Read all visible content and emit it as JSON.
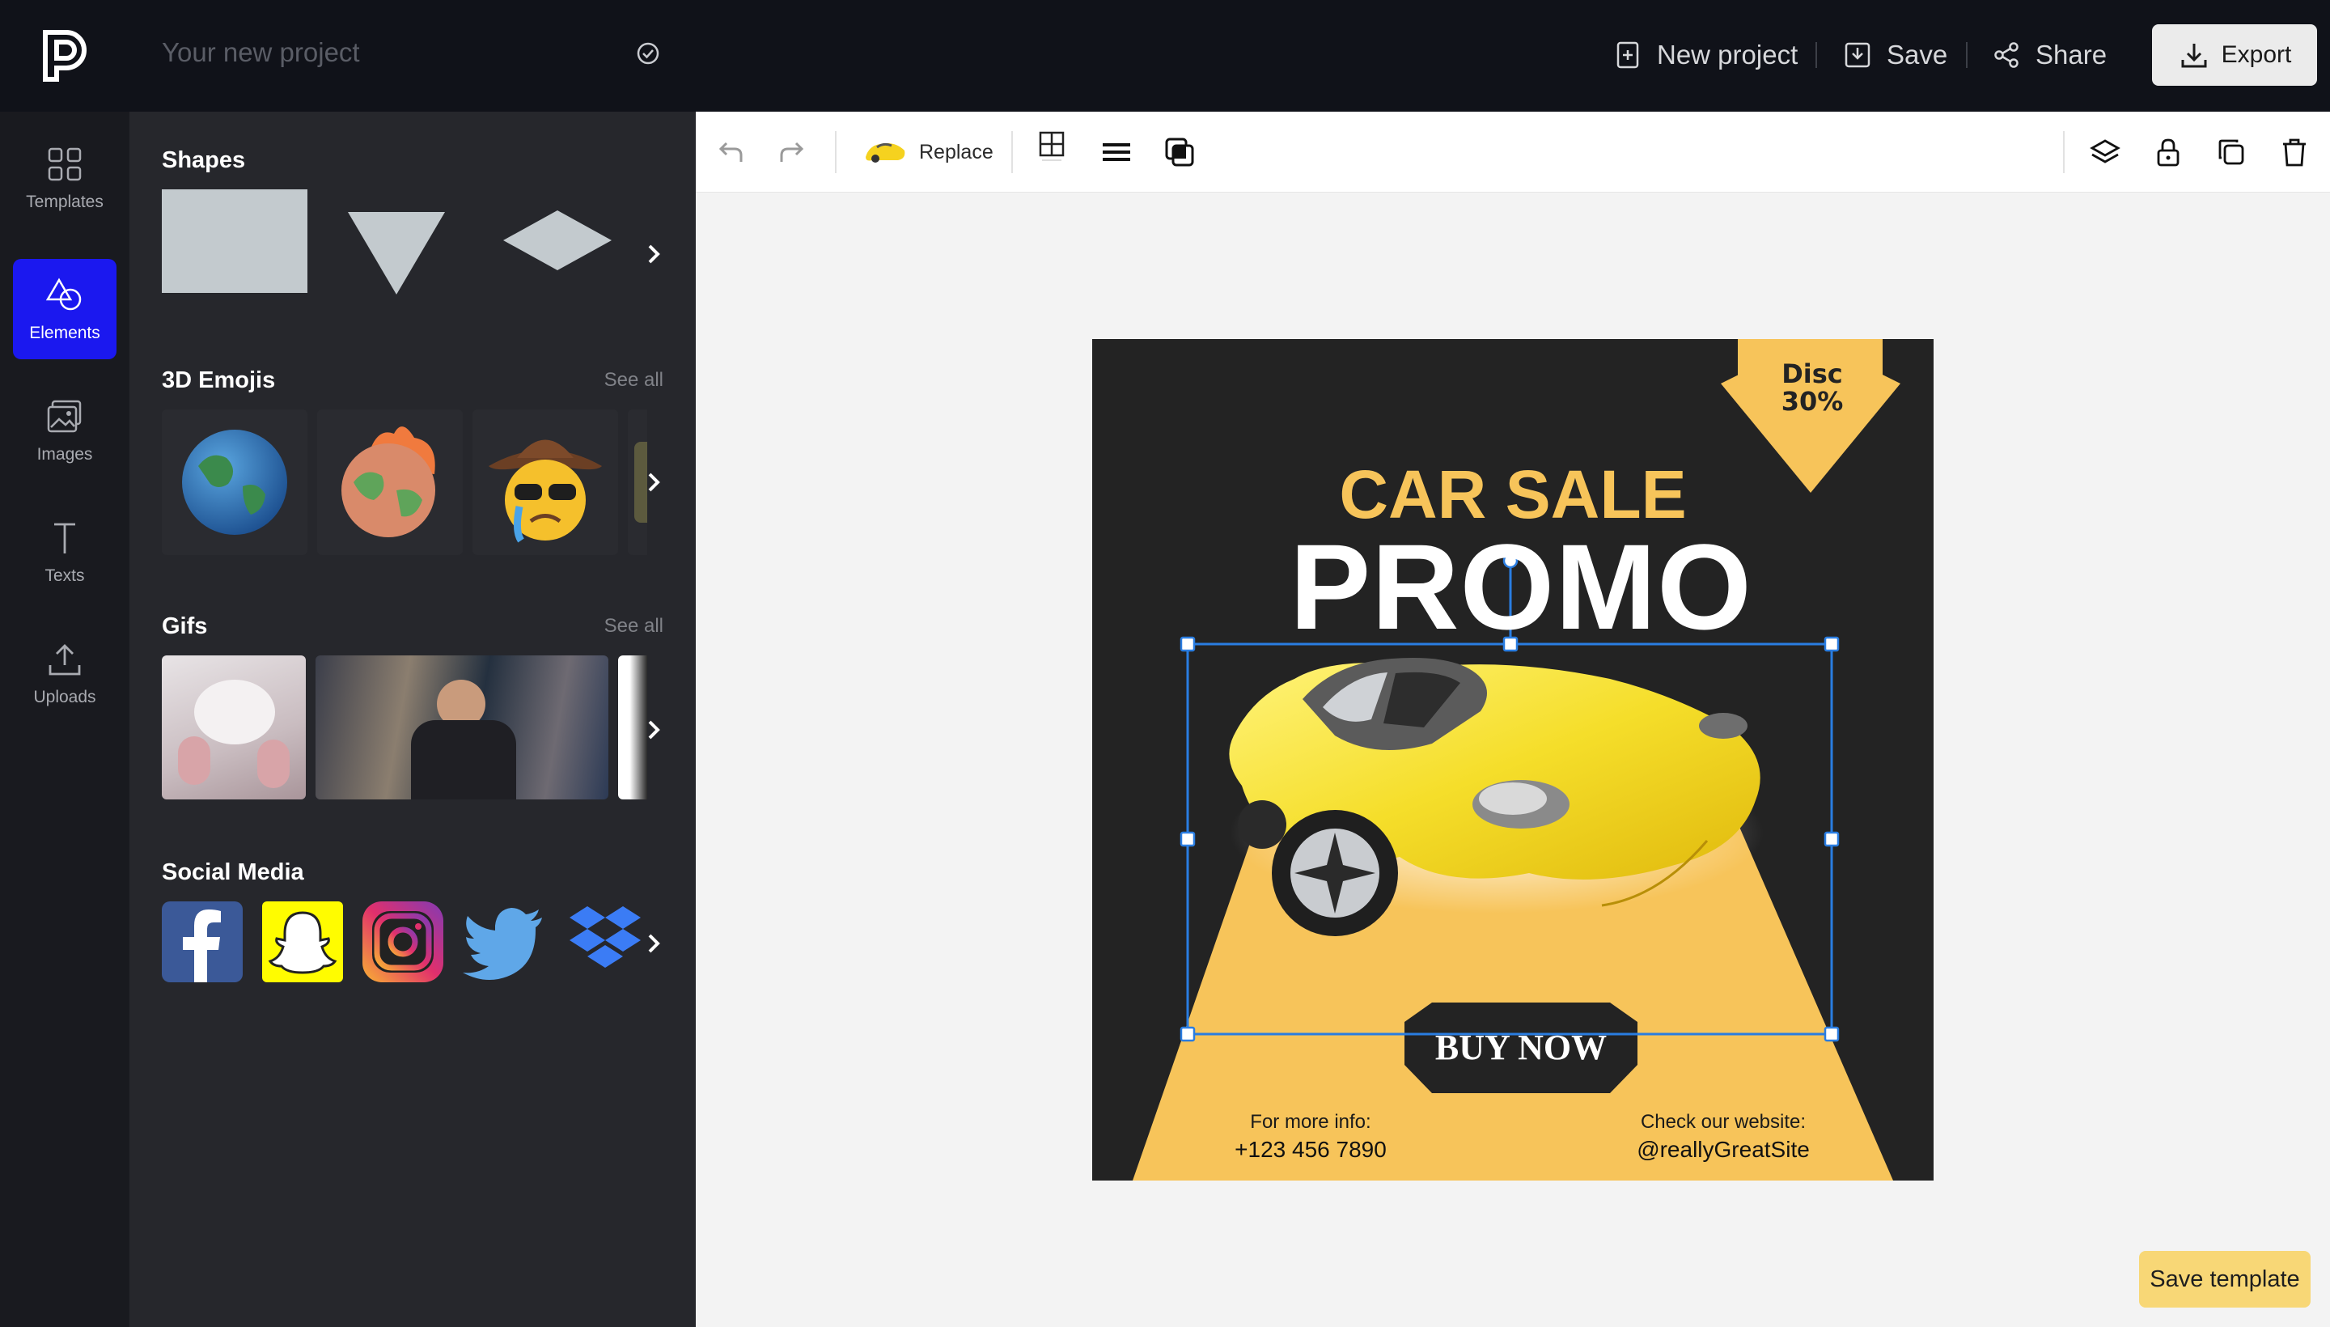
{
  "topbar": {
    "project_name": "Your new project",
    "new_project": "New project",
    "save": "Save",
    "share": "Share",
    "export": "Export"
  },
  "sidebar": {
    "items": [
      {
        "label": "Templates",
        "icon": "grid-icon"
      },
      {
        "label": "Elements",
        "icon": "shapes-icon",
        "active": true
      },
      {
        "label": "Images",
        "icon": "images-icon"
      },
      {
        "label": "Texts",
        "icon": "text-icon"
      },
      {
        "label": "Uploads",
        "icon": "upload-icon"
      }
    ]
  },
  "panel": {
    "shapes_title": "Shapes",
    "emojis_title": "3D Emojis",
    "emojis_see_all": "See all",
    "gifs_title": "Gifs",
    "gifs_see_all": "See all",
    "social_title": "Social Media",
    "social_icons": [
      "facebook-icon",
      "snapchat-icon",
      "instagram-icon",
      "twitter-icon",
      "dropbox-icon"
    ]
  },
  "toolbar": {
    "replace": "Replace"
  },
  "design": {
    "badge_line1": "Disc",
    "badge_line2": "30%",
    "headline": "CAR SALE",
    "subheadline": "PROMO",
    "cta": "BUY NOW",
    "info_label": "For more info:",
    "phone": "+123 456 7890",
    "website_label": "Check our website:",
    "website": "@reallyGreatSite"
  },
  "colors": {
    "accent_yellow": "#f7c45a",
    "card_dark": "#232323",
    "active_nav": "#1b18ef",
    "selection_blue": "#2a7de1"
  },
  "footer": {
    "save_template": "Save template"
  }
}
